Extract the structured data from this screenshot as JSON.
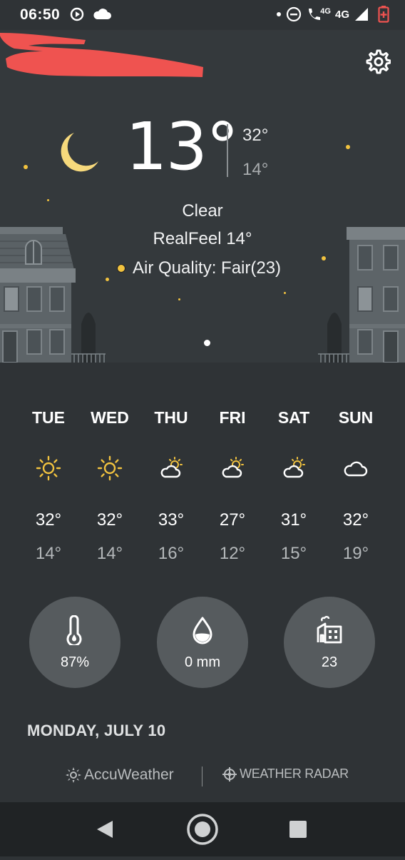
{
  "status_bar": {
    "time": "06:50",
    "network_label_1": "4G",
    "network_label_2": "4G",
    "icons": [
      "media-play-icon",
      "cloud-icon",
      "dot-icon",
      "do-not-disturb-icon",
      "volte-call-icon",
      "signal-icon",
      "battery-icon"
    ]
  },
  "current": {
    "temperature": "13°",
    "high": "32°",
    "low": "14°",
    "condition": "Clear",
    "realfeel": "RealFeel 14°",
    "air_quality": "Air Quality: Fair(23)",
    "icon": "moon-icon"
  },
  "forecast": {
    "days": [
      {
        "name": "TUE",
        "icon": "sun-icon",
        "high": "32°",
        "low": "14°"
      },
      {
        "name": "WED",
        "icon": "sun-icon",
        "high": "32°",
        "low": "14°"
      },
      {
        "name": "THU",
        "icon": "partly-cloudy-icon",
        "high": "33°",
        "low": "16°"
      },
      {
        "name": "FRI",
        "icon": "partly-cloudy-icon",
        "high": "27°",
        "low": "12°"
      },
      {
        "name": "SAT",
        "icon": "partly-cloudy-icon",
        "high": "31°",
        "low": "15°"
      },
      {
        "name": "SUN",
        "icon": "cloud-icon",
        "high": "32°",
        "low": "19°"
      }
    ]
  },
  "details": {
    "humidity": {
      "icon": "humidity-thermometer-icon",
      "value": "87%"
    },
    "precipitation": {
      "icon": "water-drop-icon",
      "value": "0 mm"
    },
    "air_quality": {
      "icon": "factory-icon",
      "value": "23"
    }
  },
  "date_heading": "MONDAY, JULY 10",
  "footer": {
    "accuweather": "AccuWeather",
    "radar": "WEATHER RADAR"
  },
  "colors": {
    "hero_bg": "#34393c",
    "body_bg": "#2f3336",
    "moon": "#f6d97c",
    "sun": "#f2c33f",
    "circle_bg": "#565b5e",
    "redaction": "#ef5350"
  }
}
